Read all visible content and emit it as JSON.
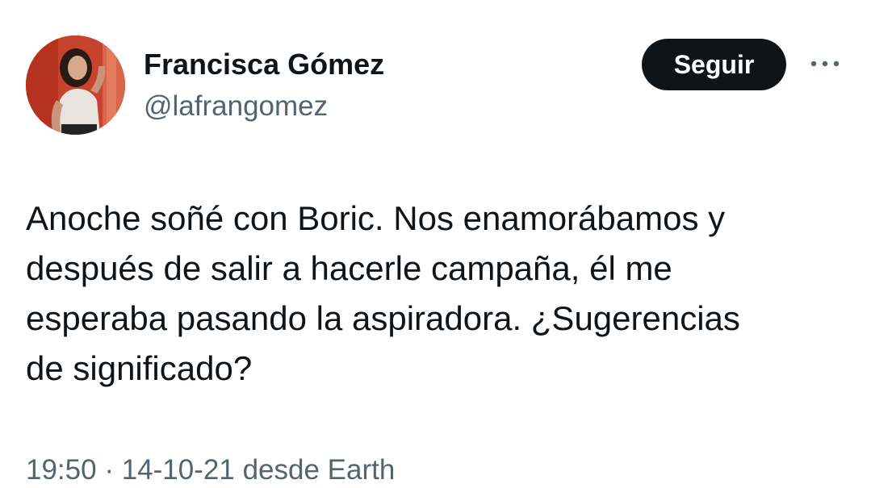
{
  "author": {
    "display_name": "Francisca Gómez",
    "handle": "@lafrangomez"
  },
  "follow_button_label": "Seguir",
  "more_icon": "more-horizontal-icon",
  "tweet": {
    "text_lines": [
      "Anoche soñé con Boric. Nos enamorábamos y",
      "después de salir a hacerle campaña, él me",
      "esperaba pasando la aspiradora. ¿Sugerencias",
      "de significado?"
    ]
  },
  "meta": {
    "time": "19:50",
    "separator": "·",
    "date": "14-10-21",
    "source": "desde Earth"
  },
  "colors": {
    "text_primary": "#0f1419",
    "text_secondary": "#536471",
    "button_bg": "#0f1419",
    "button_text": "#ffffff"
  }
}
